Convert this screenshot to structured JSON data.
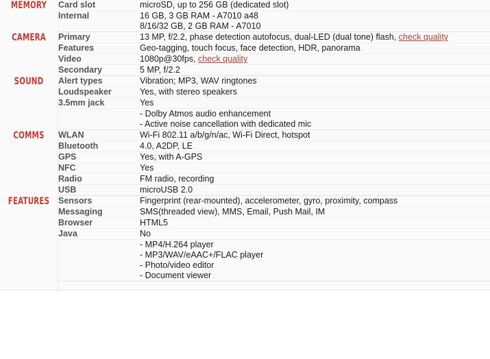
{
  "page": {
    "background": "#fafafa",
    "accent_category": "#bf3d34",
    "link_color": "#a8443a",
    "label_color": "#555555",
    "value_color": "#1a1a1a"
  },
  "sections": [
    {
      "category": "MEMORY",
      "rows": [
        {
          "label": "Card slot",
          "lines": [
            "microSD, up to 256 GB (dedicated slot)"
          ]
        },
        {
          "label": "Internal",
          "lines": [
            "16 GB, 3 GB RAM - A7010 a48",
            "8/16/32 GB, 2 GB RAM - A7010"
          ]
        }
      ]
    },
    {
      "category": "CAMERA",
      "rows": [
        {
          "label": "Primary",
          "lines": [
            "13 MP, f/2.2, phase detection autofocus, dual-LED (dual tone) flash,"
          ],
          "link": "check quality"
        },
        {
          "label": "Features",
          "lines": [
            "Geo-tagging, touch focus, face detection, HDR, panorama"
          ]
        },
        {
          "label": "Video",
          "lines": [
            "1080p@30fps,"
          ],
          "link": "check quality"
        },
        {
          "label": "Secondary",
          "lines": [
            "5 MP, f/2.2"
          ]
        }
      ]
    },
    {
      "category": "SOUND",
      "rows": [
        {
          "label": "Alert types",
          "lines": [
            "Vibration; MP3, WAV ringtones"
          ]
        },
        {
          "label": "Loudspeaker",
          "lines": [
            "Yes, with stereo speakers"
          ]
        },
        {
          "label": "3.5mm jack",
          "lines": [
            "Yes"
          ]
        },
        {
          "label": "",
          "lines": [
            "- Dolby Atmos audio enhancement",
            "- Active noise cancellation with dedicated mic"
          ]
        }
      ]
    },
    {
      "category": "COMMS",
      "rows": [
        {
          "label": "WLAN",
          "lines": [
            "Wi-Fi 802.11 a/b/g/n/ac, Wi-Fi Direct, hotspot"
          ]
        },
        {
          "label": "Bluetooth",
          "lines": [
            "4.0, A2DP, LE"
          ]
        },
        {
          "label": "GPS",
          "lines": [
            "Yes, with A-GPS"
          ]
        },
        {
          "label": "NFC",
          "lines": [
            "Yes"
          ]
        },
        {
          "label": "Radio",
          "lines": [
            "FM radio, recording"
          ]
        },
        {
          "label": "USB",
          "lines": [
            "microUSB 2.0"
          ]
        }
      ]
    },
    {
      "category": "FEATURES",
      "rows": [
        {
          "label": "Sensors",
          "lines": [
            "Fingerprint (rear-mounted), accelerometer, gyro, proximity, compass"
          ]
        },
        {
          "label": "Messaging",
          "lines": [
            "SMS(threaded view), MMS, Email, Push Mail, IM"
          ]
        },
        {
          "label": "Browser",
          "lines": [
            "HTML5"
          ]
        },
        {
          "label": "Java",
          "lines": [
            "No"
          ]
        },
        {
          "label": "",
          "lines": [
            "- MP4/H.264 player",
            "- MP3/WAV/eAAC+/FLAC player",
            "- Photo/video editor",
            "- Document viewer"
          ]
        }
      ]
    }
  ]
}
